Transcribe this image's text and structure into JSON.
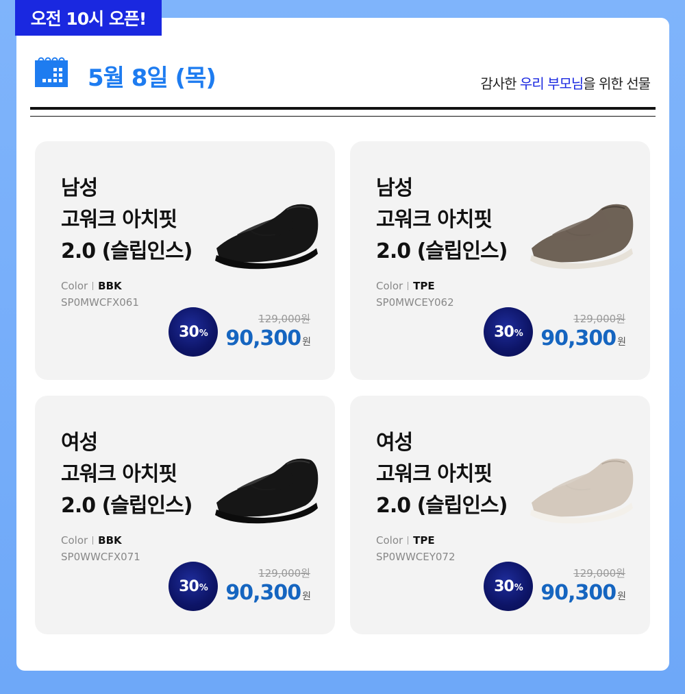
{
  "badge": {
    "open_label": "오전 10시 오픈!"
  },
  "header": {
    "date": "5월 8일 (목)",
    "tagline_pre": "감사한 ",
    "tagline_hl": "우리 부모님",
    "tagline_post": "을 위한 선물"
  },
  "colors": {
    "accent": "#1a28e0",
    "date": "#1e7cf0",
    "price": "#1565c0",
    "card_bg": "#f3f3f3"
  },
  "products": [
    {
      "line1": "남성",
      "line2": "고워크 아치핏",
      "line3": "2.0 (슬립인스)",
      "color_label": "Color",
      "color_value": "BBK",
      "sku": "SP0MWCFX061",
      "discount": "30",
      "discount_unit": "%",
      "original_price": "129,000원",
      "price": "90,300",
      "price_unit": "원",
      "shoe_color": "black"
    },
    {
      "line1": "남성",
      "line2": "고워크 아치핏",
      "line3": "2.0 (슬립인스)",
      "color_label": "Color",
      "color_value": "TPE",
      "sku": "SP0MWCEY062",
      "discount": "30",
      "discount_unit": "%",
      "original_price": "129,000원",
      "price": "90,300",
      "price_unit": "원",
      "shoe_color": "taupe-dark"
    },
    {
      "line1": "여성",
      "line2": "고워크 아치핏",
      "line3": "2.0 (슬립인스)",
      "color_label": "Color",
      "color_value": "BBK",
      "sku": "SP0WWCFX071",
      "discount": "30",
      "discount_unit": "%",
      "original_price": "129,000원",
      "price": "90,300",
      "price_unit": "원",
      "shoe_color": "black"
    },
    {
      "line1": "여성",
      "line2": "고워크 아치핏",
      "line3": "2.0 (슬립인스)",
      "color_label": "Color",
      "color_value": "TPE",
      "sku": "SP0WWCEY072",
      "discount": "30",
      "discount_unit": "%",
      "original_price": "129,000원",
      "price": "90,300",
      "price_unit": "원",
      "shoe_color": "taupe-light"
    }
  ]
}
